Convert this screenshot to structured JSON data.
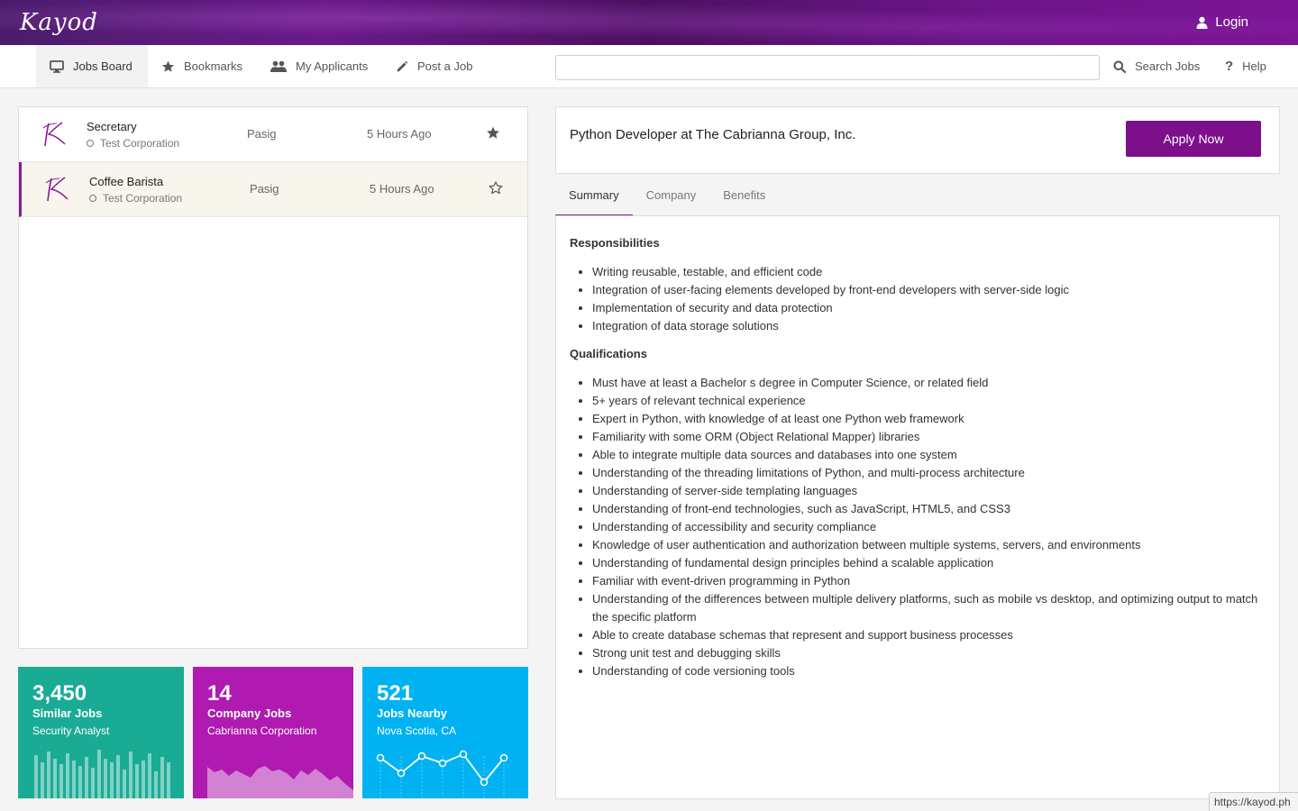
{
  "header": {
    "logo": "Kayod",
    "login_label": "Login"
  },
  "nav": {
    "items": [
      {
        "label": "Jobs Board",
        "icon": "monitor-icon",
        "active": true
      },
      {
        "label": "Bookmarks",
        "icon": "star-icon"
      },
      {
        "label": "My Applicants",
        "icon": "users-icon"
      },
      {
        "label": "Post a Job",
        "icon": "pencil-icon"
      }
    ],
    "search": {
      "value": "",
      "placeholder": ""
    },
    "search_jobs_label": "Search Jobs",
    "help_label": "Help"
  },
  "jobs": [
    {
      "title": "Secretary",
      "company": "Test Corporation",
      "location": "Pasig",
      "time": "5 Hours Ago",
      "bookmarked": true
    },
    {
      "title": "Coffee Barista",
      "company": "Test Corporation",
      "location": "Pasig",
      "time": "5 Hours Ago",
      "bookmarked": false,
      "selected": true
    }
  ],
  "stats": [
    {
      "number": "3,450",
      "label": "Similar Jobs",
      "sub": "Security Analyst",
      "color": "#1aab95",
      "chart": "bars"
    },
    {
      "number": "14",
      "label": "Company Jobs",
      "sub": "Cabrianna Corporation",
      "color": "#b01ab0",
      "chart": "area"
    },
    {
      "number": "521",
      "label": "Jobs Nearby",
      "sub": "Nova Scotia, CA",
      "color": "#00b2f2",
      "chart": "line"
    }
  ],
  "detail": {
    "title": "Python Developer at The Cabrianna Group, Inc.",
    "apply_label": "Apply Now",
    "tabs": [
      "Summary",
      "Company",
      "Benefits"
    ],
    "responsibilities_heading": "Responsibilities",
    "responsibilities": [
      "Writing reusable, testable, and efficient code",
      "Integration of user-facing elements developed by front-end developers with server-side logic",
      "Implementation of security and data protection",
      "Integration of data storage solutions"
    ],
    "qualifications_heading": "Qualifications",
    "qualifications": [
      "Must have at least a Bachelor s degree in Computer Science, or related field",
      "5+ years of relevant technical experience",
      "Expert in Python, with knowledge of at least one Python web framework",
      "Familiarity with some ORM (Object Relational Mapper) libraries",
      "Able to integrate multiple data sources and databases into one system",
      "Understanding of the threading limitations of Python, and multi-process architecture",
      "Understanding of server-side templating languages",
      "Understanding of front-end technologies, such as JavaScript, HTML5, and CSS3",
      "Understanding of accessibility and security compliance",
      "Knowledge of user authentication and authorization between multiple systems, servers, and environments",
      "Understanding of fundamental design principles behind a scalable application",
      "Familiar with event-driven programming in Python",
      "Understanding of the differences between multiple delivery platforms, such as mobile vs desktop, and optimizing output to match the specific platform",
      "Able to create database schemas that represent and support business processes",
      "Strong unit test and debugging skills",
      "Understanding of code versioning tools"
    ]
  },
  "status_url": "https://kayod.ph",
  "colors": {
    "brand": "#7d0f8a",
    "accent": "#8a1a9b"
  }
}
